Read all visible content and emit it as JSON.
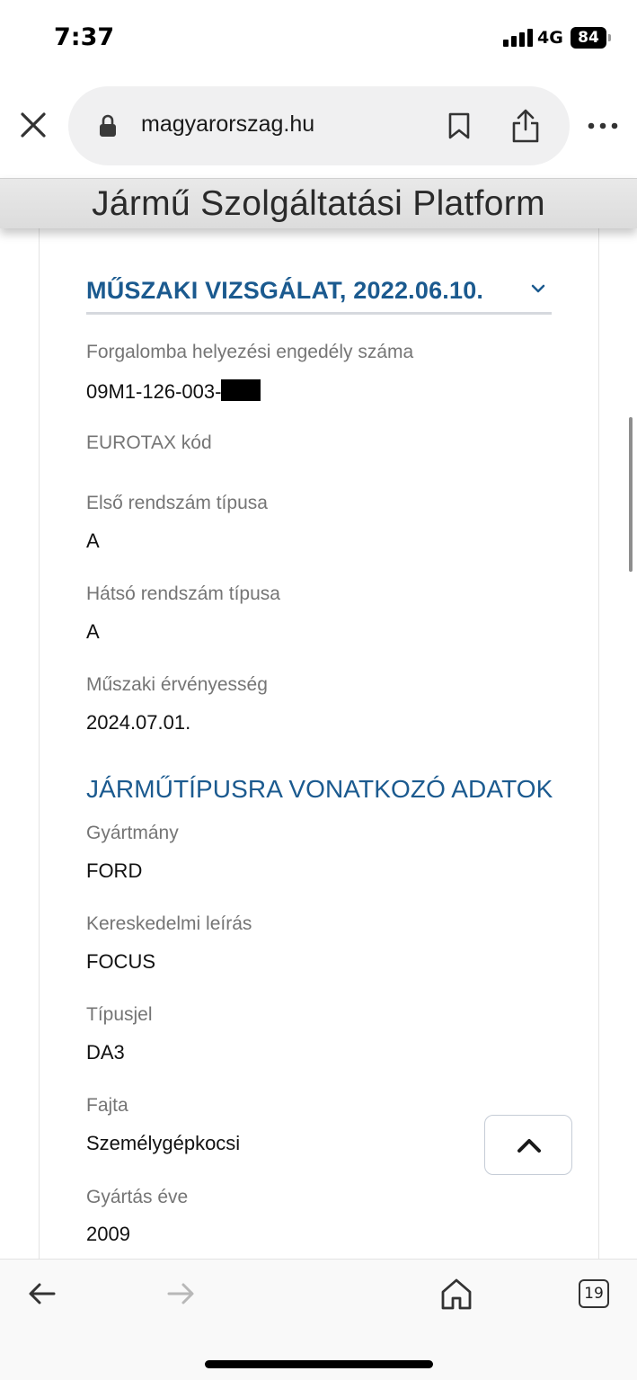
{
  "status": {
    "time": "7:37",
    "network": "4G",
    "battery": "84"
  },
  "browser": {
    "url": "magyarorszag.hu",
    "tab_count": "19"
  },
  "banner": {
    "title": "Jármű Szolgáltatási Platform"
  },
  "section": {
    "title": "MŰSZAKI VIZSGÁLAT, 2022.06.10."
  },
  "fields": [
    {
      "label": "Forgalomba helyezési engedély száma",
      "value": "09M1-126-003-"
    },
    {
      "label": "EUROTAX kód",
      "value": ""
    },
    {
      "label": "Első rendszám típusa",
      "value": "A"
    },
    {
      "label": "Hátsó rendszám típusa",
      "value": "A"
    },
    {
      "label": "Műszaki érvényesség",
      "value": "2024.07.01."
    }
  ],
  "subsection": {
    "title": "JÁRMŰTÍPUSRA VONATKOZÓ ADATOK"
  },
  "vehicle_fields": [
    {
      "label": "Gyártmány",
      "value": "FORD"
    },
    {
      "label": "Kereskedelmi leírás",
      "value": "FOCUS"
    },
    {
      "label": "Típusjel",
      "value": "DA3"
    },
    {
      "label": "Fajta",
      "value": "Személygépkocsi"
    },
    {
      "label": "Gyártás éve",
      "value": "2009"
    }
  ],
  "icons": {
    "close": "close-icon",
    "lock": "lock-icon",
    "bookmark": "bookmark-icon",
    "share": "share-icon",
    "more": "more-icon",
    "chevron": "chevron-down-icon",
    "scroll_top": "chevron-up-icon",
    "back": "arrow-left-icon",
    "forward": "arrow-right-icon",
    "home": "home-icon"
  },
  "colors": {
    "accent": "#1b5a8f",
    "label": "#757575",
    "banner_bg": "#e3e3e3"
  }
}
